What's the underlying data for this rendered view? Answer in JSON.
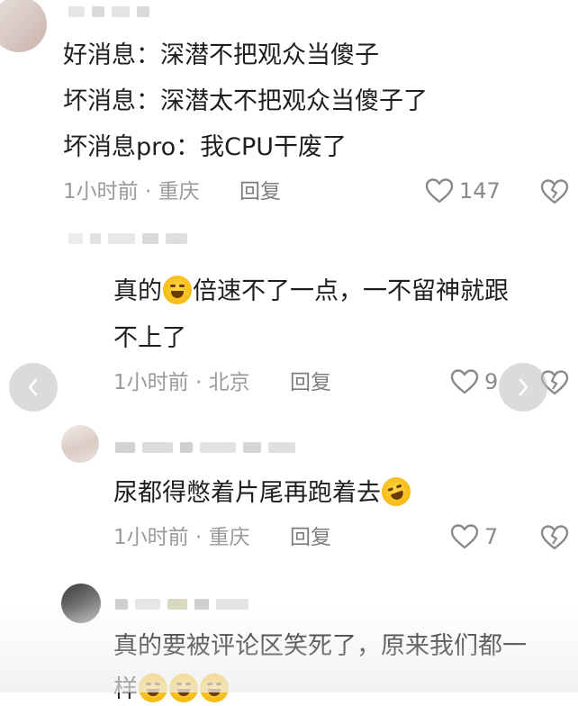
{
  "comments": [
    {
      "lines": [
        "好消息：深潜不把观众当傻子",
        "坏消息：深潜太不把观众当傻子了",
        "坏消息pro：我CPU干废了"
      ],
      "time_location": "1小时前 · 重庆",
      "reply_label": "回复",
      "like_count": "147"
    },
    {
      "line1_prefix": "真的",
      "line1_suffix": "倍速不了一点，一不留神就跟",
      "line2": "不上了",
      "time_location": "1小时前 · 北京",
      "reply_label": "回复",
      "like_count": "9"
    },
    {
      "line_prefix": "尿都得憋着片尾再跑着去",
      "time_location": "1小时前 · 重庆",
      "reply_label": "回复",
      "like_count": "7"
    },
    {
      "line1": "真的要被评论区笑死了，原来我们都一",
      "line2_prefix": "样"
    }
  ],
  "icons": {
    "like": "heart-outline-icon",
    "dislike": "broken-heart-outline-icon",
    "prev": "chevron-left-icon",
    "next": "chevron-right-icon",
    "emoji_cry": "crying-face-emoji",
    "emoji_laugh": "rolling-laughing-emoji"
  },
  "colors": {
    "text": "#1e1e1e",
    "meta": "#9a9a9a",
    "icon": "#8a8a8a"
  }
}
